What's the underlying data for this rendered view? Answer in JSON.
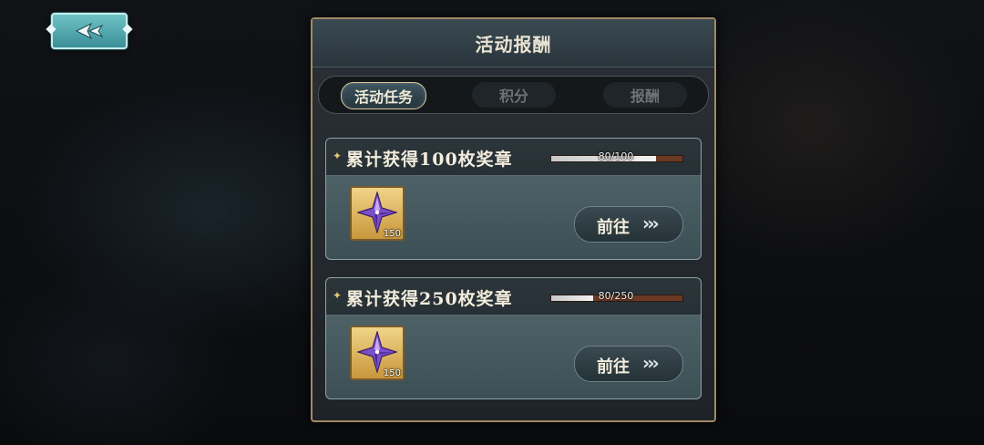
{
  "panel": {
    "title": "活动报酬"
  },
  "tabs": [
    {
      "label": "活动任务",
      "active": true
    },
    {
      "label": "积分",
      "active": false
    },
    {
      "label": "报酬",
      "active": false
    }
  ],
  "tasks": [
    {
      "title": "累计获得100枚奖章",
      "progress_text": "80/100",
      "progress_fraction": 0.8,
      "reward_icon": "purple-star-crystal-icon",
      "reward_count": "150",
      "button_label": "前往",
      "button_icon": "triple-chevron-right-icon"
    },
    {
      "title": "累计获得250枚奖章",
      "progress_text": "80/250",
      "progress_fraction": 0.32,
      "reward_icon": "purple-star-crystal-icon",
      "reward_count": "150",
      "button_label": "前往",
      "button_icon": "triple-chevron-right-icon"
    }
  ],
  "back_button": {
    "icon": "back-arrow-icon"
  },
  "colors": {
    "accent_gold": "#a08a64",
    "back_button": "#4fa8b0",
    "progress_track": "#6a3a24"
  }
}
